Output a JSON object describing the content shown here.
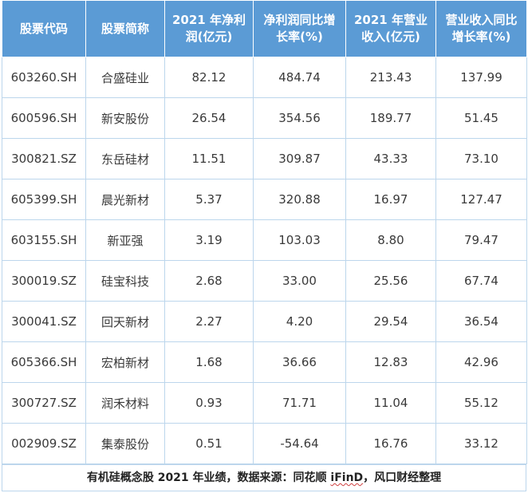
{
  "chart_data": {
    "type": "table",
    "columns": [
      "股票代码",
      "股票简称",
      "2021 年净利润(亿元)",
      "净利润同比增长率(%)",
      "2021 年营业收入(亿元)",
      "营业收入同比增长率(%)"
    ],
    "rows": [
      [
        "603260.SH",
        "合盛硅业",
        "82.12",
        "484.74",
        "213.43",
        "137.99"
      ],
      [
        "600596.SH",
        "新安股份",
        "26.54",
        "354.56",
        "189.77",
        "51.45"
      ],
      [
        "300821.SZ",
        "东岳硅材",
        "11.51",
        "309.87",
        "43.33",
        "73.10"
      ],
      [
        "605399.SH",
        "晨光新材",
        "5.37",
        "320.88",
        "16.97",
        "127.47"
      ],
      [
        "603155.SH",
        "新亚强",
        "3.19",
        "103.03",
        "8.80",
        "79.47"
      ],
      [
        "300019.SZ",
        "硅宝科技",
        "2.68",
        "33.00",
        "25.56",
        "67.74"
      ],
      [
        "300041.SZ",
        "回天新材",
        "2.27",
        "4.20",
        "29.54",
        "36.54"
      ],
      [
        "605366.SH",
        "宏柏新材",
        "1.68",
        "36.66",
        "12.83",
        "42.96"
      ],
      [
        "300727.SZ",
        "润禾材料",
        "0.93",
        "71.71",
        "11.04",
        "55.12"
      ],
      [
        "002909.SZ",
        "集泰股份",
        "0.51",
        "-54.64",
        "16.76",
        "33.12"
      ]
    ],
    "caption": {
      "before": "有机硅概念股 2021 年业绩，数据来源：同花顺 ",
      "highlight": "iFinD",
      "after": "，风口财经整理"
    },
    "header_color": "#5b9bd5",
    "border_color": "#bcd6ec"
  }
}
